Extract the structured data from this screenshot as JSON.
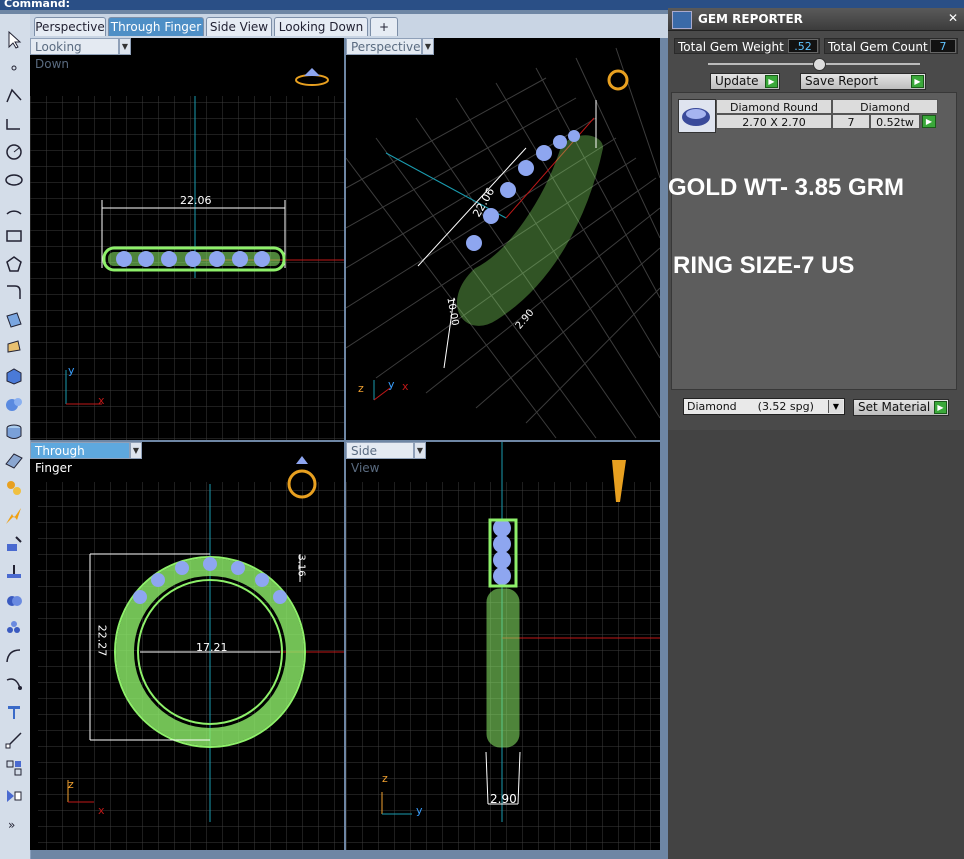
{
  "command_label": "Command:",
  "tabs": [
    {
      "label": "Perspective",
      "active": false
    },
    {
      "label": "Through Finger",
      "active": true
    },
    {
      "label": "Side View",
      "active": false
    },
    {
      "label": "Looking Down",
      "active": false
    },
    {
      "label": "+",
      "active": false
    }
  ],
  "viewports": {
    "looking_down": {
      "label": "Looking Down",
      "dim": "22.06",
      "axis_y": "y",
      "axis_x": "x"
    },
    "perspective": {
      "label": "Perspective",
      "dim_a": "22.06",
      "dim_b": "10.00",
      "dim_c": "2.90",
      "axis_z": "z",
      "axis_y": "y",
      "axis_x": "x"
    },
    "through_finger": {
      "label": "Through Finger",
      "dim_height": "22.27",
      "dim_width": "17.21",
      "dim_top": "3.16",
      "axis_z": "z",
      "axis_x": "x"
    },
    "side_view": {
      "label": "Side View",
      "dim": "2.90",
      "axis_z": "z",
      "axis_y": "y"
    }
  },
  "gem_reporter": {
    "title": "GEM REPORTER",
    "total_gem_weight_label": "Total Gem Weight",
    "total_gem_weight": ".52",
    "total_gem_count_label": "Total Gem Count",
    "total_gem_count": "7",
    "update_label": "Update",
    "save_report_label": "Save Report",
    "table": {
      "headers": [
        "Diamond Round",
        "Diamond"
      ],
      "row": {
        "size": "2.70 X 2.70",
        "count": "7",
        "weight": "0.52tw"
      }
    },
    "note_gold": "GOLD WT- 3.85 GRM",
    "note_size": "RING SIZE-7 US",
    "material_select": "Diamond      (3.52 spg)",
    "set_material_label": "Set Material"
  },
  "colors": {
    "wire": "#8ef06a",
    "gem": "#8ea6f0",
    "grid": "#3c3c3c",
    "axis_x": "#c01818",
    "axis_y": "#1a9cb0",
    "accent_tab": "#4e8fc6"
  }
}
